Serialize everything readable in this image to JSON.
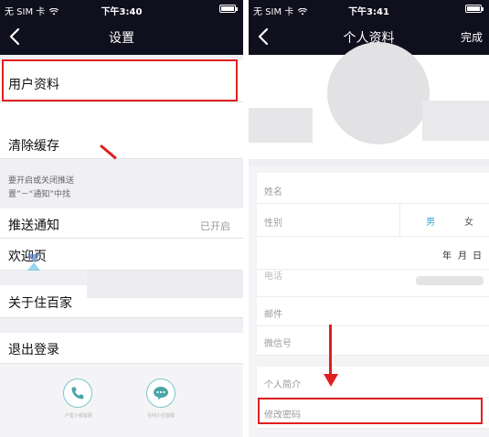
{
  "left": {
    "status": {
      "carrier": "无 SIM 卡",
      "time": "下午3:40"
    },
    "nav": {
      "title": "设置"
    },
    "items": {
      "user_profile": "用户资料",
      "clear_cache": "清除缓存",
      "hint_line1": "要开启或关闭推送",
      "hint_line2": "置”－“通知”中找",
      "push": "推送通知",
      "push_value": "已开启",
      "welcome": "欢迎页",
      "about": "关于住百家",
      "logout": "退出登录"
    },
    "bottom": {
      "phone_label": "户型小程客服",
      "chat_label": "在线小住客服"
    }
  },
  "right": {
    "status": {
      "carrier": "无 SIM 卡",
      "time": "下午3:41"
    },
    "nav": {
      "title": "个人资料",
      "done": "完成"
    },
    "fields": {
      "name": "姓名",
      "gender": "性别",
      "male": "男",
      "female": "女",
      "year": "年",
      "month": "月",
      "day": "日",
      "phone": "电话",
      "email": "邮件",
      "wechat": "微信号",
      "intro": "个人简介",
      "change_password": "修改密码"
    }
  },
  "colors": {
    "nav_bg": "#0f0f1d",
    "highlight": "#e02020",
    "accent_male": "#3aa6d8",
    "icon_teal": "#4aa6a6"
  }
}
